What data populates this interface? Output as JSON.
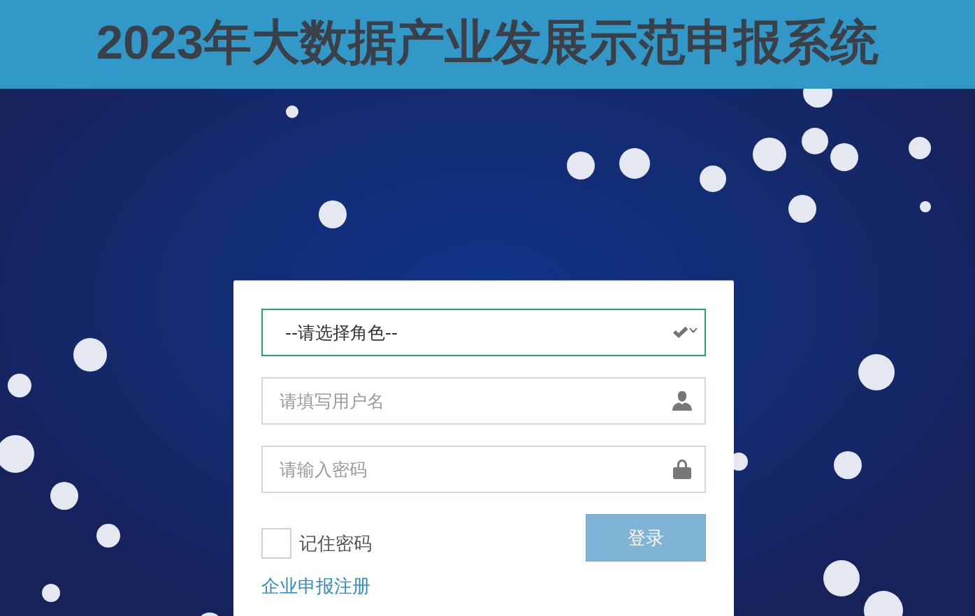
{
  "header": {
    "title": "2023年大数据产业发展示范申报系统"
  },
  "login_form": {
    "role_select": {
      "value": "--请选择角色--",
      "focused": true
    },
    "fields": [
      {
        "kind": "username",
        "placeholder": "请填写用户名"
      },
      {
        "kind": "password",
        "placeholder": "请输入密码"
      }
    ],
    "remember": {
      "label": "记住密码",
      "checked": false
    },
    "login_button": {
      "label": "登录"
    },
    "register_link": {
      "label": "企业申报注册"
    }
  }
}
